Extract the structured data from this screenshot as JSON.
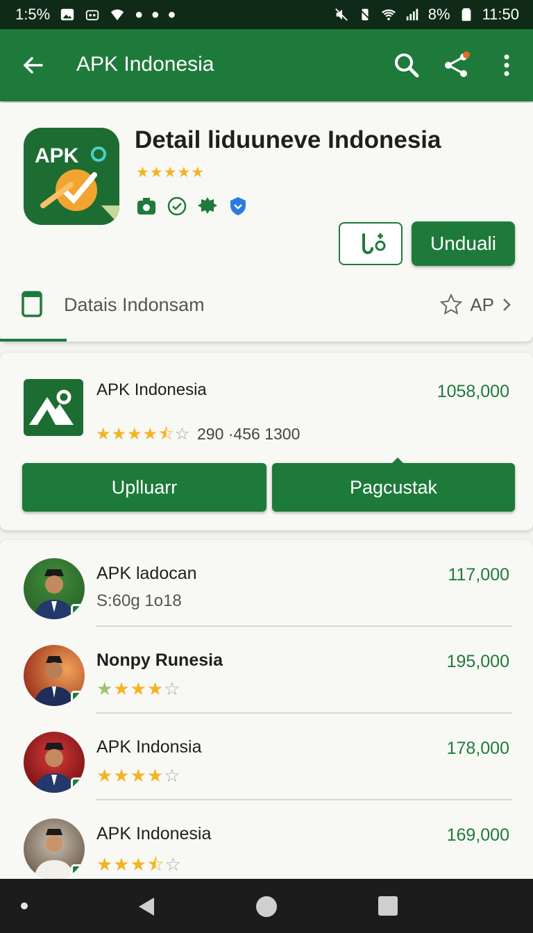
{
  "status_bar": {
    "left_text": "1:5%",
    "battery": "8%",
    "time": "11:50"
  },
  "app_bar": {
    "title": "APK Indonesia"
  },
  "app_detail": {
    "icon_text": "APK",
    "name": "Detail liduuneve Indonesia",
    "rating_stars": "★★★★★",
    "install_label": "Unduali",
    "tab_label": "Datais Indonsam",
    "tab_right_label": "AP"
  },
  "featured": {
    "name": "APK Indonesia",
    "price": "1058,000",
    "meta": "290 ·456 1300",
    "btn_left": "Uplluarr",
    "btn_right": "Pagcustak"
  },
  "list_items": [
    {
      "name": "APK ladocan",
      "sub": "S:60g 1o18",
      "price": "117,000"
    },
    {
      "name": "Nonpy Runesia",
      "price": "195,000",
      "rating": 4
    },
    {
      "name": "APK Indonsia",
      "price": "178,000",
      "rating": 4
    },
    {
      "name": "APK Indonesia",
      "price": "169,000",
      "rating": 3.5
    }
  ],
  "colors": {
    "primary": "#1e7a3b",
    "star": "#f4b321",
    "status_bar": "#0f2a17"
  }
}
